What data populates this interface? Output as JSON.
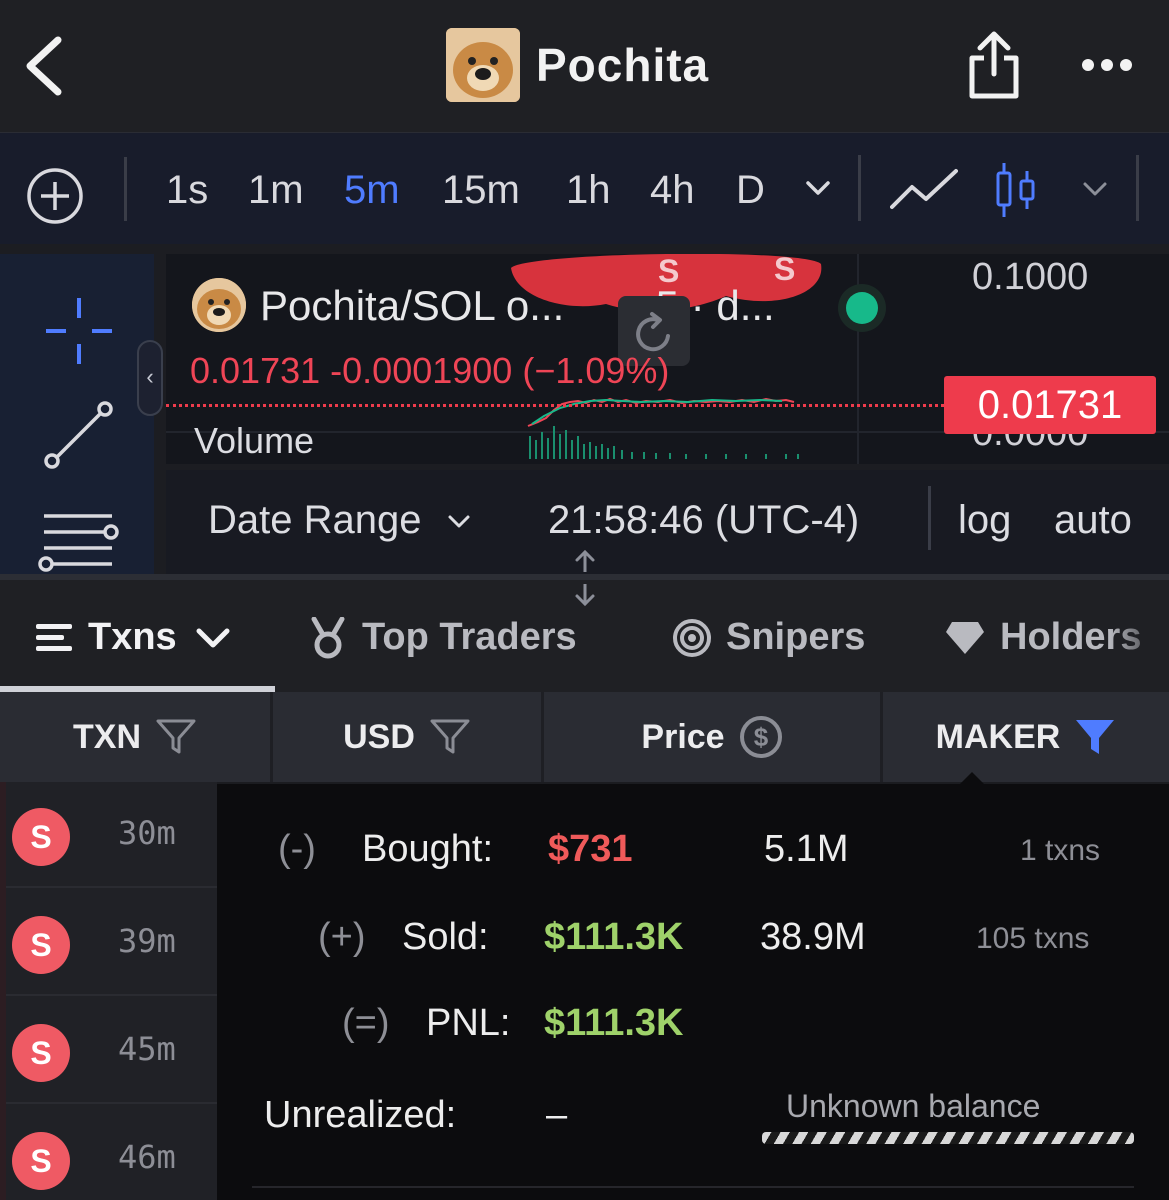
{
  "header": {
    "title": "Pochita"
  },
  "toolbar": {
    "timeframes": [
      "1s",
      "1m",
      "5m",
      "15m",
      "1h",
      "4h",
      "D"
    ],
    "active_timeframe": "5m",
    "accent_color": "#4f7cff"
  },
  "chart": {
    "pair_label": "Pochita/SOL o...",
    "interval_label": "· 5 · d...",
    "price": "0.01731",
    "change": "-0.0001900",
    "change_pct": "(−1.09%)",
    "volume_label": "Volume",
    "axis_top": "0.1000",
    "axis_bottom": "0.0000",
    "price_tag": "0.01731",
    "date_range_label": "Date Range",
    "clock": "21:58:46 (UTC-4)",
    "log_label": "log",
    "auto_label": "auto",
    "down_color": "#ee3b4c",
    "up_color": "#17b98a"
  },
  "tabs": [
    {
      "label": "Txns",
      "icon": "list-icon",
      "active": true
    },
    {
      "label": "Top Traders",
      "icon": "medal-icon"
    },
    {
      "label": "Snipers",
      "icon": "target-icon"
    },
    {
      "label": "Holders",
      "icon": "diamond-icon"
    }
  ],
  "table": {
    "headers": [
      "TXN",
      "USD",
      "Price",
      "MAKER"
    ],
    "rows": [
      {
        "type": "S",
        "age": "30m"
      },
      {
        "type": "S",
        "age": "39m"
      },
      {
        "type": "S",
        "age": "45m"
      },
      {
        "type": "S",
        "age": "46m"
      }
    ]
  },
  "maker_popover": {
    "bought_prefix": "(-)",
    "bought_label": "Bought:",
    "bought_usd": "$731",
    "bought_tokens": "5.1M",
    "bought_txns": "1 txns",
    "sold_prefix": "(+)",
    "sold_label": "Sold:",
    "sold_usd": "$111.3K",
    "sold_tokens": "38.9M",
    "sold_txns": "105 txns",
    "pnl_prefix": "(=)",
    "pnl_label": "PNL:",
    "pnl_usd": "$111.3K",
    "unrealized_label": "Unrealized:",
    "unrealized_value": "–",
    "unknown_balance": "Unknown balance"
  }
}
